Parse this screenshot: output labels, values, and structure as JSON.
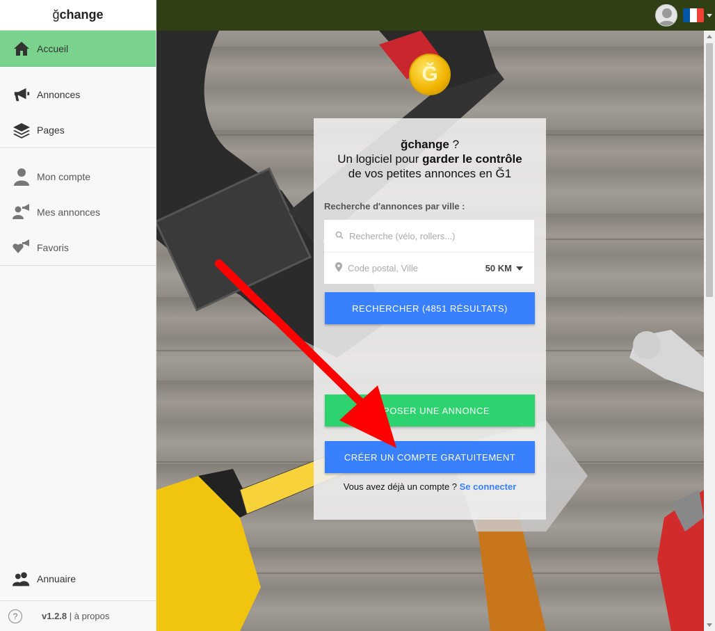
{
  "app": {
    "logo_prefix": "ğ",
    "logo_suffix": "change"
  },
  "sidebar": {
    "items": [
      {
        "label": "Accueil",
        "icon": "home-icon",
        "active": true
      },
      {
        "label": "Annonces",
        "icon": "megaphone-icon"
      },
      {
        "label": "Pages",
        "icon": "layers-icon"
      },
      {
        "label": "Mon compte",
        "icon": "person-icon"
      },
      {
        "label": "Mes annonces",
        "icon": "person-megaphone-icon"
      },
      {
        "label": "Favoris",
        "icon": "heart-megaphone-icon"
      }
    ],
    "directory": {
      "label": "Annuaire",
      "icon": "people-icon"
    },
    "version": "v1.2.8",
    "about": "| à propos",
    "help": "?"
  },
  "topbar": {
    "avatar_icon": "user-avatar-icon",
    "flag_icon": "french-flag-icon",
    "flag_colors": [
      "#0055a4",
      "#ffffff",
      "#ef4135"
    ]
  },
  "hero": {
    "coin_symbol": "Ğ",
    "title_name": "ğchange",
    "title_q": " ?",
    "line2_prefix": "Un logiciel pour ",
    "line2_bold": "garder le contrôle",
    "line3": "de vos petites annonces en Ğ1",
    "search_label": "Recherche d'annonces par ville :",
    "search_placeholder": "Recherche (vélo, rollers...)",
    "location_placeholder": "Code postal, Ville",
    "distance": "50 KM",
    "search_button": "RECHERCHER (4851 RÉSULTATS)",
    "post_button": "DÉPOSER UNE ANNONCE",
    "create_button": "CRÉER UN COMPTE GRATUITEMENT",
    "login_prompt": "Vous avez déjà un compte ? ",
    "login_link": "Se connecter"
  },
  "colors": {
    "accent_green": "#79d38d",
    "topbar": "#303f14",
    "primary_blue": "#3880ff",
    "success_green": "#2dd36f",
    "arrow_red": "#ff0000"
  }
}
